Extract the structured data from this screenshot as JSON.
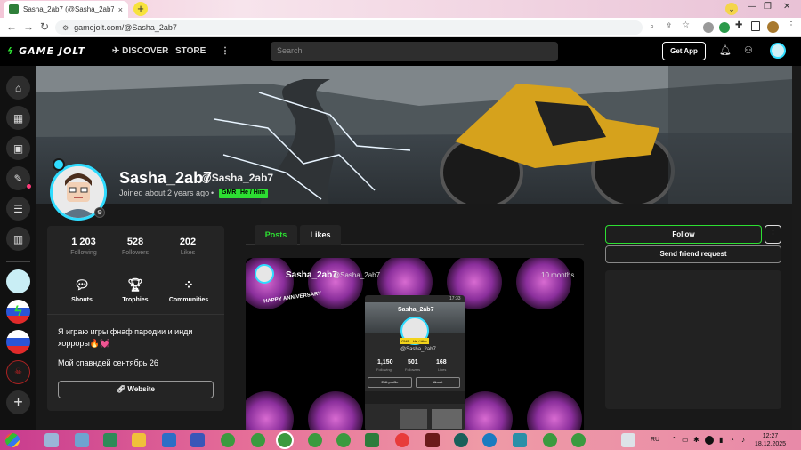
{
  "browser": {
    "tab_title": "Sasha_2ab7 (@Sasha_2ab7) - Ga",
    "tab_close": "×",
    "new_tab": "+",
    "url": "gamejolt.com/@Sasha_2ab7"
  },
  "header": {
    "logo": "GAME JOLT",
    "discover": "DISCOVER",
    "store": "STORE",
    "search_placeholder": "Search",
    "get_app": "Get App"
  },
  "profile": {
    "name": "Sasha_2ab7",
    "handle": "@Sasha_2ab7",
    "joined": "Joined about 2 years ago",
    "tags": [
      "GMR",
      "He / Him"
    ]
  },
  "stats": [
    {
      "value": "1 203",
      "label": "Following"
    },
    {
      "value": "528",
      "label": "Followers"
    },
    {
      "value": "202",
      "label": "Likes"
    }
  ],
  "quick_actions": [
    {
      "label": "Shouts",
      "icon": "shouts-icon"
    },
    {
      "label": "Trophies",
      "icon": "trophy-icon"
    },
    {
      "label": "Communities",
      "icon": "communities-icon"
    }
  ],
  "bio": {
    "line1": "Я играю игры фнаф пародии и инди хорроры🔥💓",
    "line2": "Мой спавндей сентябрь 26",
    "website": "Website"
  },
  "tabs": {
    "posts": "Posts",
    "likes": "Likes"
  },
  "post": {
    "author": "Sasha_2ab7",
    "handle": "@Sasha_2ab7",
    "time": "10 months",
    "image_text": {
      "status_time": "17:33",
      "name": "Sasha_2ab7",
      "tags": [
        "GMR",
        "He / Him"
      ],
      "handle": "@Sasha_2ab7",
      "following": "1,150",
      "following_label": "Following",
      "followers": "501",
      "followers_label": "Followers",
      "likes": "168",
      "likes_label": "Likes",
      "edit": "Edit profile",
      "about": "About",
      "banner": "HAPPY ANNIVERSARY"
    }
  },
  "actions": {
    "follow": "Follow",
    "more": "⋮",
    "friend": "Send friend request"
  },
  "taskbar": {
    "lang": "RU",
    "time": "12:27",
    "date": "18.12.2025"
  },
  "colors": {
    "accent": "#2ddf32",
    "avatar_ring": "#2fdcff",
    "background": "#191919"
  }
}
